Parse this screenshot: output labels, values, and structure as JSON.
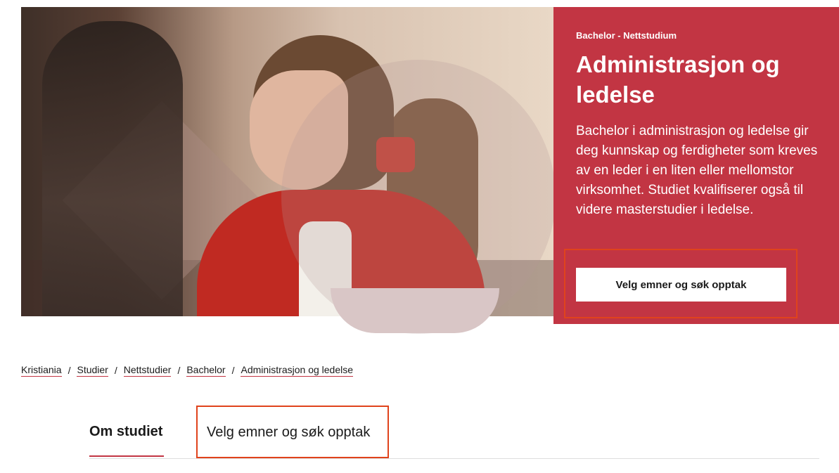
{
  "hero": {
    "kicker": "Bachelor - Nettstudium",
    "title": "Administrasjon og ledelse",
    "description": "Bachelor i administrasjon og ledelse gir deg kunnskap og ferdigheter som kreves av en leder i en liten eller mellomstor virksomhet. Studiet kvalifiserer også til videre masterstudier i ledelse.",
    "cta_label": "Velg emner og søk opptak",
    "panel_color": "#c23543",
    "highlight_color": "#e0431c"
  },
  "breadcrumb": {
    "items": [
      "Kristiania",
      "Studier",
      "Nettstudier",
      "Bachelor",
      "Administrasjon og ledelse"
    ],
    "separator": "/"
  },
  "tabs": [
    {
      "label": "Om studiet",
      "active": true
    },
    {
      "label": "Velg emner og søk opptak",
      "active": false
    }
  ]
}
